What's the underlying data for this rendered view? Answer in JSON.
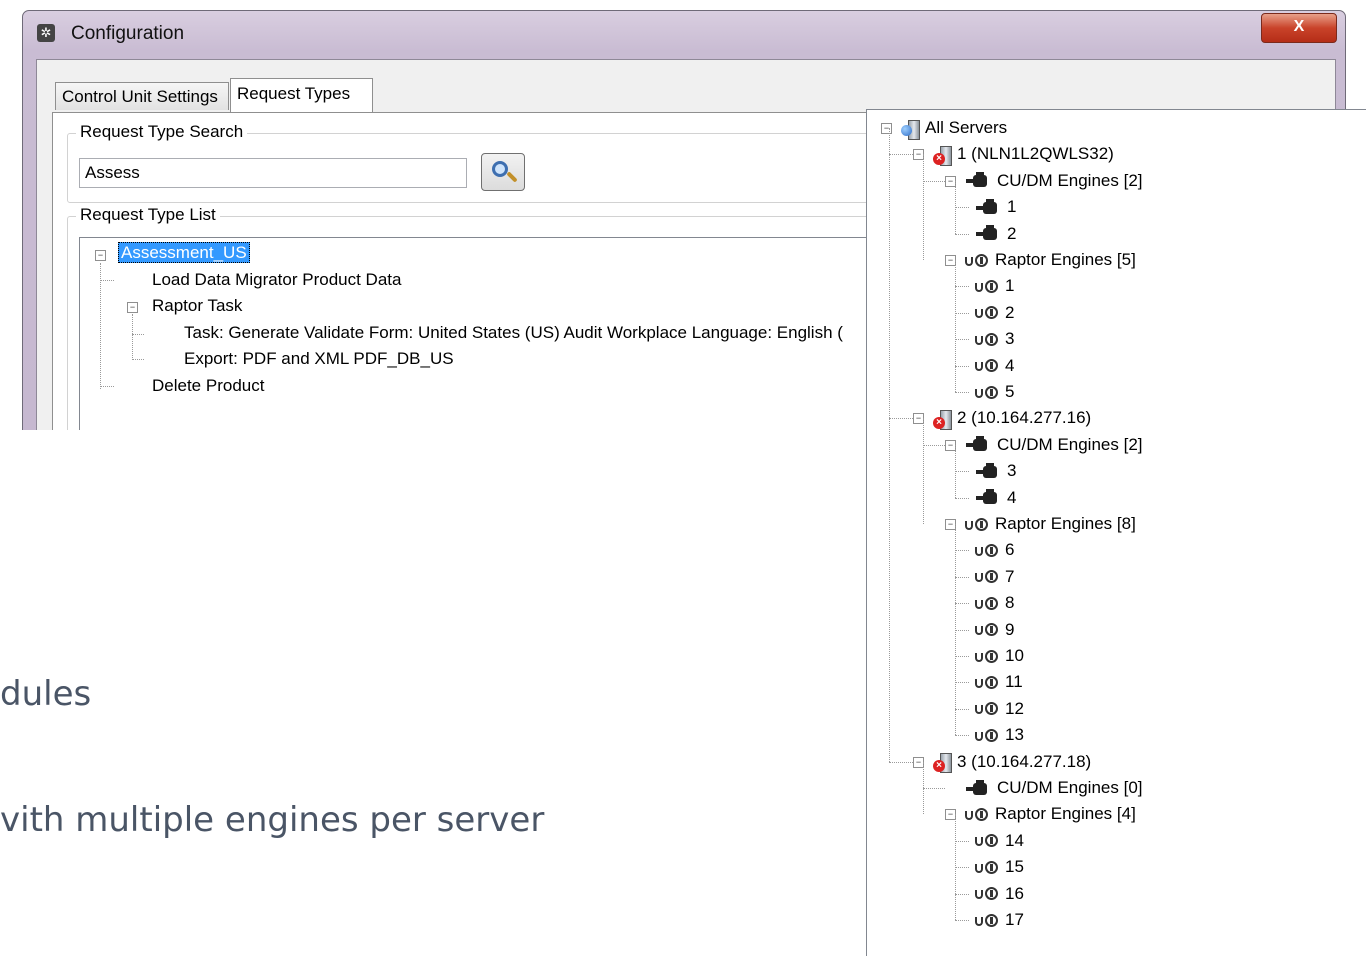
{
  "window": {
    "title": "Configuration",
    "close_label": "X"
  },
  "tabs": [
    {
      "label": "Control Unit Settings"
    },
    {
      "label": "Request Types"
    }
  ],
  "search": {
    "group_label": "Request Type Search",
    "value": "Assess"
  },
  "request_list": {
    "group_label": "Request Type List",
    "items": [
      {
        "label": "Assessment_US"
      },
      {
        "label": "Load Data Migrator Product Data"
      },
      {
        "label": "Raptor Task"
      },
      {
        "label": "Task: Generate Validate  Form: United States (US) Audit Workplace Language: English ("
      },
      {
        "label": "Export: PDF and XML PDF_DB_US"
      },
      {
        "label": "Delete Product"
      }
    ]
  },
  "slide": {
    "line1": "dules",
    "line2": "vith multiple engines per server"
  },
  "server_tree": {
    "root": "All Servers",
    "servers": [
      {
        "label": "1 (NLN1L2QWLS32)",
        "cu_label": "CU/DM Engines [2]",
        "cu_engines": [
          "1",
          "2"
        ],
        "raptor_label": "Raptor Engines [5]",
        "raptor_engines": [
          "1",
          "2",
          "3",
          "4",
          "5"
        ]
      },
      {
        "label": "2 (10.164.277.16)",
        "cu_label": "CU/DM Engines [2]",
        "cu_engines": [
          "3",
          "4"
        ],
        "raptor_label": "Raptor Engines [8]",
        "raptor_engines": [
          "6",
          "7",
          "8",
          "9",
          "10",
          "11",
          "12",
          "13"
        ]
      },
      {
        "label": "3 (10.164.277.18)",
        "cu_label": "CU/DM Engines [0]",
        "cu_engines": [],
        "raptor_label": "Raptor Engines [4]",
        "raptor_engines": [
          "14",
          "15",
          "16",
          "17"
        ]
      }
    ]
  }
}
